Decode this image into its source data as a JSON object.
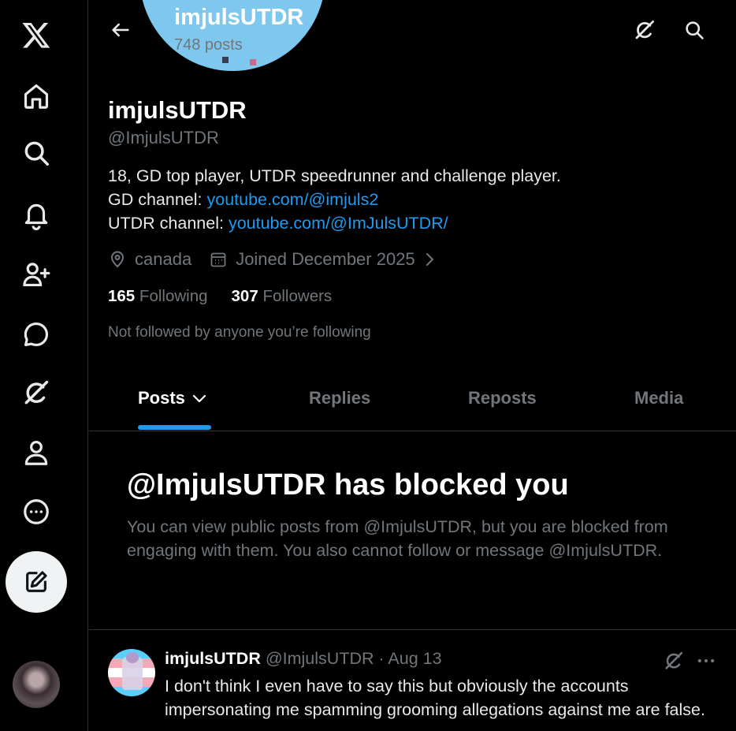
{
  "sidebar": {
    "items": [
      {
        "name": "x-logo-icon"
      },
      {
        "name": "home-icon"
      },
      {
        "name": "search-icon"
      },
      {
        "name": "notifications-icon"
      },
      {
        "name": "follow-icon"
      },
      {
        "name": "messages-icon"
      },
      {
        "name": "grok-icon"
      },
      {
        "name": "profile-icon"
      },
      {
        "name": "more-icon"
      }
    ],
    "compose_icon": "compose-icon"
  },
  "header": {
    "title": "imjulsUTDR",
    "post_count": "748 posts"
  },
  "profile": {
    "display_name": "imjulsUTDR",
    "handle": "@ImjulsUTDR",
    "bio_line1": "18, GD top player, UTDR speedrunner and challenge player.",
    "bio_gd_label": "GD channel: ",
    "bio_gd_link": "youtube.com/@imjuls2",
    "bio_utdr_label": "UTDR channel: ",
    "bio_utdr_link": "youtube.com/@ImJulsUTDR/",
    "location": "canada",
    "joined": "Joined December 2025",
    "following_count": "165",
    "following_label": "Following",
    "followers_count": "307",
    "followers_label": "Followers",
    "not_followed": "Not followed by anyone you’re following"
  },
  "tabs": [
    {
      "label": "Posts"
    },
    {
      "label": "Replies"
    },
    {
      "label": "Reposts"
    },
    {
      "label": "Media"
    }
  ],
  "blocked": {
    "title": "@ImjulsUTDR has blocked you",
    "body": "You can view public posts from @ImjulsUTDR, but you are blocked from engaging with them. You also cannot follow or message @ImjulsUTDR."
  },
  "post": {
    "author": "imjulsUTDR",
    "handle_date": " @ImjulsUTDR · Aug 13",
    "text": "I don't think I even have to say this but obviously the accounts impersonating me spamming grooming allegations against me are false."
  },
  "colors": {
    "background": "#000000",
    "text_primary": "#e7e9ea",
    "text_secondary": "#71767b",
    "accent": "#1d9bf0",
    "divider": "#2f3336"
  }
}
